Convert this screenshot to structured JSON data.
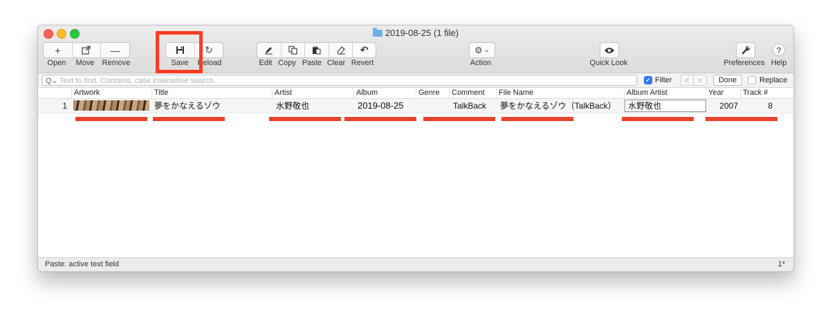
{
  "window": {
    "title": "2019-08-25 (1 file)"
  },
  "toolbar": {
    "open": "Open",
    "move": "Move",
    "remove": "Remove",
    "save": "Save",
    "reload": "Reload",
    "edit": "Edit",
    "copy": "Copy",
    "paste": "Paste",
    "clear": "Clear",
    "revert": "Revert",
    "action": "Action",
    "quicklook": "Quick Look",
    "preferences": "Preferences",
    "help": "Help",
    "icons": {
      "plus": "+",
      "minus": "—",
      "reload": "↻",
      "revert": "↶",
      "gear": "⚙",
      "chevron": "⌄",
      "eye": "◉",
      "help": "?"
    }
  },
  "search": {
    "placeholder": "Text to find. Contains, case insensitive search.",
    "filter_label": "Filter",
    "filter_checked": true,
    "done_label": "Done",
    "replace_label": "Replace",
    "prev": "<",
    "next": ">"
  },
  "table": {
    "columns": [
      "Artwork",
      "Title",
      "Artist",
      "Album",
      "Genre",
      "Comment",
      "File Name",
      "Album Artist",
      "Year",
      "Track #"
    ],
    "rows": [
      {
        "index": "1",
        "title": "夢をかなえるゾウ",
        "artist": "水野敬也",
        "album": "2019-08-25",
        "genre": "",
        "comment": "TalkBack",
        "filename": "夢をかなえるゾウ（TalkBack）",
        "album_artist": "水野敬也",
        "year": "2007",
        "track": "8"
      }
    ]
  },
  "status": {
    "text": "Paste: active text field",
    "count": "1*"
  },
  "colors": {
    "highlight": "#ff3b1f",
    "underline": "#e8412c",
    "checkbox": "#2f7bf5"
  }
}
